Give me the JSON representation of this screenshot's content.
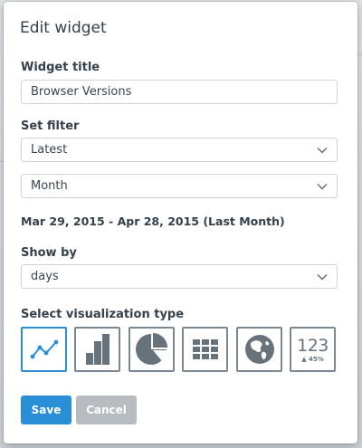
{
  "dialog": {
    "title": "Edit widget"
  },
  "widget_title": {
    "label": "Widget title",
    "value": "Browser Versions"
  },
  "filter": {
    "label": "Set filter",
    "primary": {
      "selected": "Latest"
    },
    "period": {
      "selected": "Month"
    },
    "date_range": "Mar 29, 2015 - Apr 28, 2015 (Last Month)"
  },
  "show_by": {
    "label": "Show by",
    "selected": "days"
  },
  "visualization": {
    "label": "Select visualization type",
    "selected": "line-chart",
    "options": [
      {
        "id": "line-chart",
        "icon": "line-chart-icon"
      },
      {
        "id": "bar-chart",
        "icon": "bar-chart-icon"
      },
      {
        "id": "pie-chart",
        "icon": "pie-chart-icon"
      },
      {
        "id": "table",
        "icon": "table-grid-icon"
      },
      {
        "id": "map",
        "icon": "globe-icon"
      },
      {
        "id": "number",
        "icon": "number-icon",
        "number_text": "123",
        "trend_text": "45%"
      }
    ]
  },
  "actions": {
    "save_label": "Save",
    "cancel_label": "Cancel"
  },
  "colors": {
    "primary": "#2b8fd8",
    "cancel": "#b7bcc1",
    "icon": "#68727b",
    "text": "#34404b"
  }
}
